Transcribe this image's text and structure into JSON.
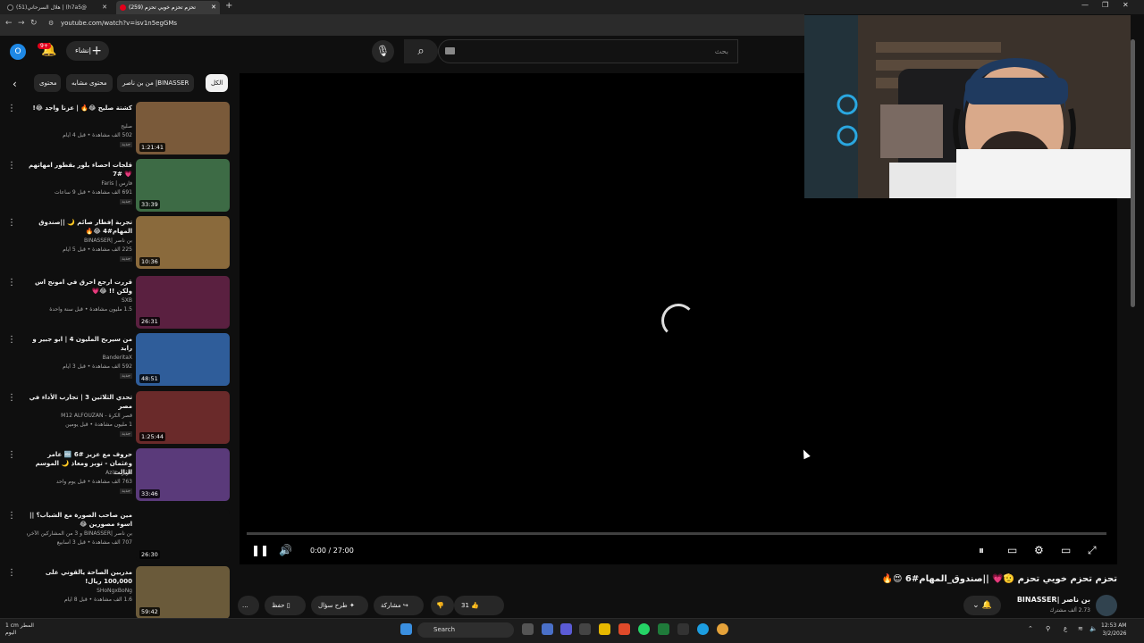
{
  "browser": {
    "tabs": [
      {
        "label": "(51)هلال السرحاني | (h7a5@",
        "active": false
      },
      {
        "label": "(259) تحزم تحزم خويي تحزم",
        "active": true
      }
    ],
    "url": "youtube.com/watch?v=isv1n5egGMs"
  },
  "header": {
    "avatar_letter": "O",
    "notifications": "9+",
    "create_label": "إنشاء",
    "search_placeholder": "بحث"
  },
  "chips": [
    {
      "label": "الكل",
      "selected": true
    },
    {
      "label": "من بن ناصر |BINASSER",
      "selected": false
    },
    {
      "label": "محتوى مشابه",
      "selected": false
    },
    {
      "label": "محتوى",
      "selected": false
    }
  ],
  "recommendations": [
    {
      "title": "كشتة صليح 😂🔥 | عزنا واجد 😂!",
      "channel": "صليح",
      "meta": "502 ألف مشاهدة • قبل 4 أيام",
      "badge": "جديد",
      "duration": "1:21:41",
      "thumb_color": "#7a5a3a"
    },
    {
      "title": "قلجات احصاء بلور بقطور امهاتهم 💗 #7",
      "channel": "فارس | Faris",
      "meta": "691 ألف مشاهدة • قبل 9 ساعات",
      "badge": "جديد",
      "duration": "33:39",
      "thumb_color": "#3d6b45"
    },
    {
      "title": "تجربة إفطار صائم 🌙 ||صندوق المهام#4 😂🔥",
      "channel": "بن ناصر |BINASSER",
      "meta": "225 ألف مشاهدة • قبل 5 أيام",
      "badge": "جديد",
      "duration": "10:36",
      "thumb_color": "#8a6a3c"
    },
    {
      "title": "قررت ارجع احرق في امونج اس ولكن !! 😂💗",
      "channel": "SXB",
      "meta": "1.5 مليون مشاهدة • قبل سنة واحدة",
      "badge": "",
      "duration": "26:31",
      "thumb_color": "#5a2040"
    },
    {
      "title": "من سيربح المليون 4 | ابو جبير و رايد",
      "channel": "BanderitaX",
      "meta": "592 ألف مشاهدة • قبل 3 أيام",
      "badge": "جديد",
      "duration": "48:51",
      "thumb_color": "#2f5d9a"
    },
    {
      "title": "تحدي الثلاثين 3 | تجارب الأداء في مصر",
      "channel": "قصر الكرة - M12 ALFOUZAN",
      "meta": "1 مليون مشاهدة • قبل يومين",
      "badge": "جديد",
      "duration": "1:25:44",
      "thumb_color": "#6a2a2a"
    },
    {
      "title": "حروف مع عزيز #6 🔤 عامر وعثمان - توبز ومعاذ 🌙 الموسم الثالث",
      "channel": "عزيز - Aziz",
      "meta": "763 ألف مشاهدة • قبل يوم واحد",
      "badge": "جديد",
      "duration": "33:46",
      "thumb_color": "#5a3a7a"
    },
    {
      "title": "مين صاحب الصورة مع الشباب؟ || اسوء مصورين 😂",
      "channel": "بن ناصر |BINASSER و 3 من المشاركين الآخرين",
      "meta": "707 ألف مشاهدة • قبل 3 أسابيع",
      "badge": "",
      "duration": "26:30",
      "thumb_color": "#0f0f0f"
    },
    {
      "title": "مدربين الصاحة يالقوني على 100,000 ريال!",
      "channel": "SHoNgxBoNg",
      "meta": "1.6 ألف مشاهدة • قبل 8 أيام",
      "badge": "",
      "duration": "59:42",
      "thumb_color": "#6a5a3a"
    }
  ],
  "player": {
    "time": "0:00 / 27:00",
    "progress": 0
  },
  "video": {
    "title": "تحزم تحزم خويي تحزم 🫡💗 ||صندوق_المهام#6 😍🔥",
    "channel": "بن ناصر |BINASSER",
    "subs": "2.73 ألف مشترك",
    "likes": "31",
    "share_label": "مشاركة",
    "ask_label": "طرح سؤال",
    "save_label": "حفظ",
    "more_label": "..."
  },
  "taskbar": {
    "weather_line1": "1 cm المطر",
    "weather_line2": "اليوم",
    "search_label": "Search",
    "time": "12:53 AM",
    "date": "3/2/2026",
    "lang": "ع"
  }
}
